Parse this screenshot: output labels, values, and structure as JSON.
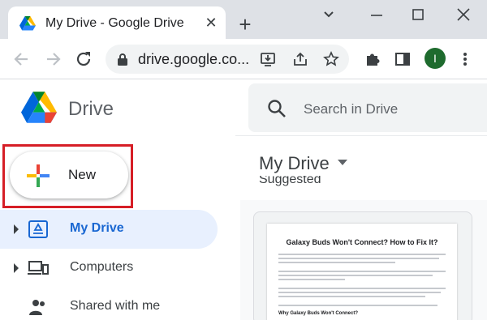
{
  "browser": {
    "tab_title": "My Drive - Google Drive",
    "url": "drive.google.co...",
    "profile_initial": "I",
    "colors": {
      "tabstrip": "#dee1e6",
      "profile": "#1e6b2e"
    }
  },
  "drive": {
    "brand": "Drive",
    "search": {
      "placeholder": "Search in Drive"
    },
    "new_button": {
      "label": "New",
      "highlight_color": "#d61e26"
    },
    "nav": [
      {
        "label": "My Drive",
        "icon": "my-drive-icon",
        "active": true
      },
      {
        "label": "Computers",
        "icon": "computers-icon",
        "active": false
      },
      {
        "label": "Shared with me",
        "icon": "shared-with-me-icon",
        "active": false
      }
    ],
    "main": {
      "title": "My Drive",
      "section": "Suggested",
      "file_preview": {
        "doc_title": "Galaxy Buds Won't Connect? How to Fix It?",
        "doc_subheading": "Why Galaxy Buds Won't Connect?"
      }
    }
  }
}
